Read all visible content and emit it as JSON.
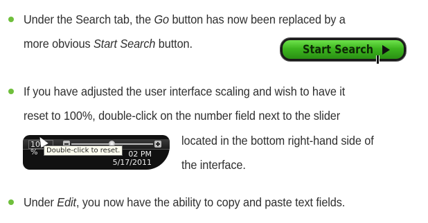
{
  "accent_color": "#6fbf3c",
  "bullets": [
    {
      "lines": [
        [
          "Under the Search tab, the ",
          {
            "i": "Go"
          },
          " button has now been replaced by a"
        ],
        [
          "more obvious ",
          {
            "i": "Start Search"
          },
          " button."
        ]
      ]
    },
    {
      "lines": [
        [
          "If you have adjusted the user interface scaling and wish to have it"
        ],
        [
          "reset to 100%, double-click on the number field next to the slider"
        ],
        [
          "located in the bottom right-hand side of"
        ],
        [
          "the interface."
        ]
      ]
    },
    {
      "lines": [
        [
          "Under ",
          {
            "i": "Edit"
          },
          ", you now have the ability to copy and paste text fields."
        ]
      ]
    }
  ],
  "start_search_button": {
    "label": "Start Search",
    "icon": "play-icon"
  },
  "zoom_widget": {
    "value": "100 %",
    "tooltip": "Double-click to reset.",
    "time": "02 PM",
    "date": "5/17/2011"
  }
}
